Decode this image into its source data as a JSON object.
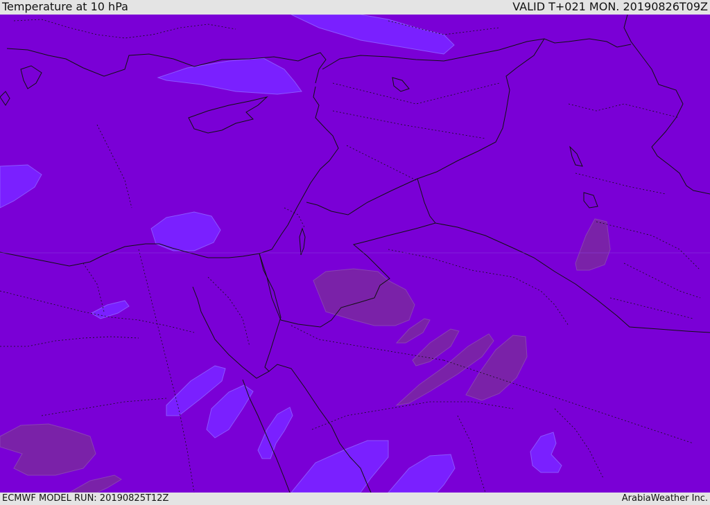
{
  "header": {
    "title": "Temperature at 10 hPa",
    "valid": "VALID T+021 MON. 20190826T09Z"
  },
  "footer": {
    "model_run": "ECMWF MODEL RUN: 20190825T12Z",
    "credit": "ArabiaWeather Inc."
  },
  "map": {
    "field_colors": {
      "background": "#7a00d6",
      "cold_patch": "#7a20ff",
      "warm_patch": "#7a22a8"
    }
  }
}
